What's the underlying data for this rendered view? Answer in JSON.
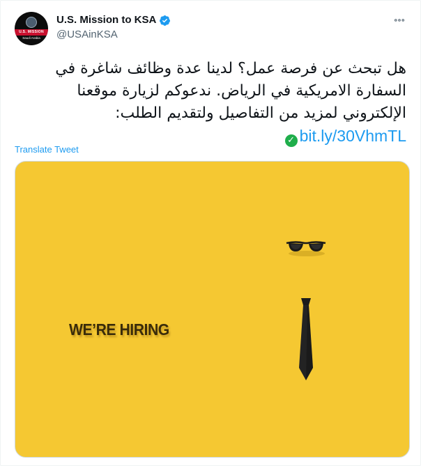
{
  "account": {
    "display_name": "U.S. Mission to KSA",
    "handle": "@USAinKSA",
    "avatar_band_text": "U.S. MISSION",
    "avatar_sub_text": "Saudi Arabia"
  },
  "tweet": {
    "lines": [
      "هل تبحث عن فرصة عمل؟ لدينا عدة وظائف شاغرة في",
      "السفارة الامريكية في الرياض. ندعوكم لزيارة موقعنا",
      "الإلكتروني لمزيد من التفاصيل ولتقديم الطلب:"
    ],
    "link_text": "bit.ly/30VhmTL",
    "translate_label": "Translate Tweet"
  },
  "media": {
    "headline": "WE’RE HIRING"
  },
  "colors": {
    "accent": "#1d9bf0",
    "media_background": "#f5c832",
    "check_emoji": "#1fae4b"
  },
  "icons": {
    "verified": "verified-badge-icon",
    "more": "more-options-icon",
    "link_prefix": "check-mark-emoji-icon"
  }
}
